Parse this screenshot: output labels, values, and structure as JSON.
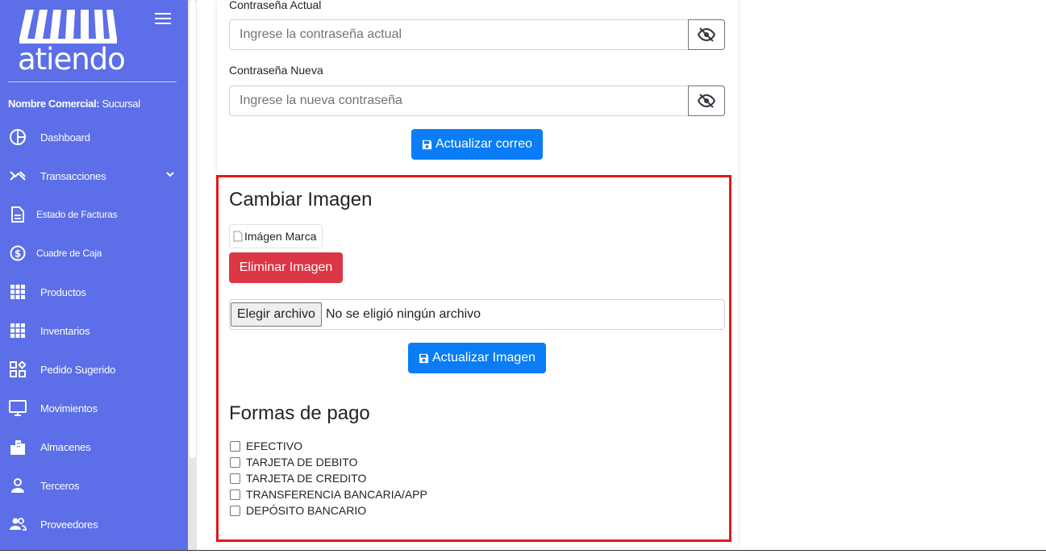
{
  "sidebar": {
    "logo_text": "atiendo",
    "business_label": "Nombre Comercial:",
    "business_value": "Sucursal",
    "items": [
      {
        "label": "Dashboard",
        "icon": "pie-chart-icon"
      },
      {
        "label": "Transacciones",
        "icon": "transactions-icon"
      },
      {
        "label": "Estado de Facturas",
        "icon": "document-icon"
      },
      {
        "label": "Cuadre de Caja",
        "icon": "dollar-circle-icon"
      },
      {
        "label": "Productos",
        "icon": "grid-icon"
      },
      {
        "label": "Inventarios",
        "icon": "grid-icon"
      },
      {
        "label": "Pedido Sugerido",
        "icon": "widgets-icon"
      },
      {
        "label": "Movimientos",
        "icon": "monitor-icon"
      },
      {
        "label": "Almacenes",
        "icon": "buildings-icon"
      },
      {
        "label": "Terceros",
        "icon": "person-icon"
      },
      {
        "label": "Proveedores",
        "icon": "people-icon"
      }
    ]
  },
  "password": {
    "current_label": "Contraseña Actual",
    "current_placeholder": "Ingrese la contraseña actual",
    "new_label": "Contraseña Nueva",
    "new_placeholder": "Ingrese la nueva contraseña",
    "update_button": "Actualizar correo"
  },
  "image_section": {
    "title": "Cambiar Imagen",
    "image_alt": "Imágen Marca",
    "delete_button": "Eliminar Imagen",
    "file_button": "Elegir archivo",
    "file_status": "No se eligió ningún archivo",
    "update_button": "Actualizar Imagen"
  },
  "payment": {
    "title": "Formas de pago",
    "options": [
      {
        "label": "EFECTIVO",
        "checked": false
      },
      {
        "label": "TARJETA DE DEBITO",
        "checked": false
      },
      {
        "label": "TARJETA DE CREDITO",
        "checked": false
      },
      {
        "label": "TRANSFERENCIA BANCARIA/APP",
        "checked": false
      },
      {
        "label": "DEPÓSITO BANCARIO",
        "checked": false
      }
    ]
  },
  "colors": {
    "sidebar": "#5c6ee8",
    "primary": "#0a7df6",
    "danger": "#dc3545",
    "highlight": "#e01b1b"
  }
}
